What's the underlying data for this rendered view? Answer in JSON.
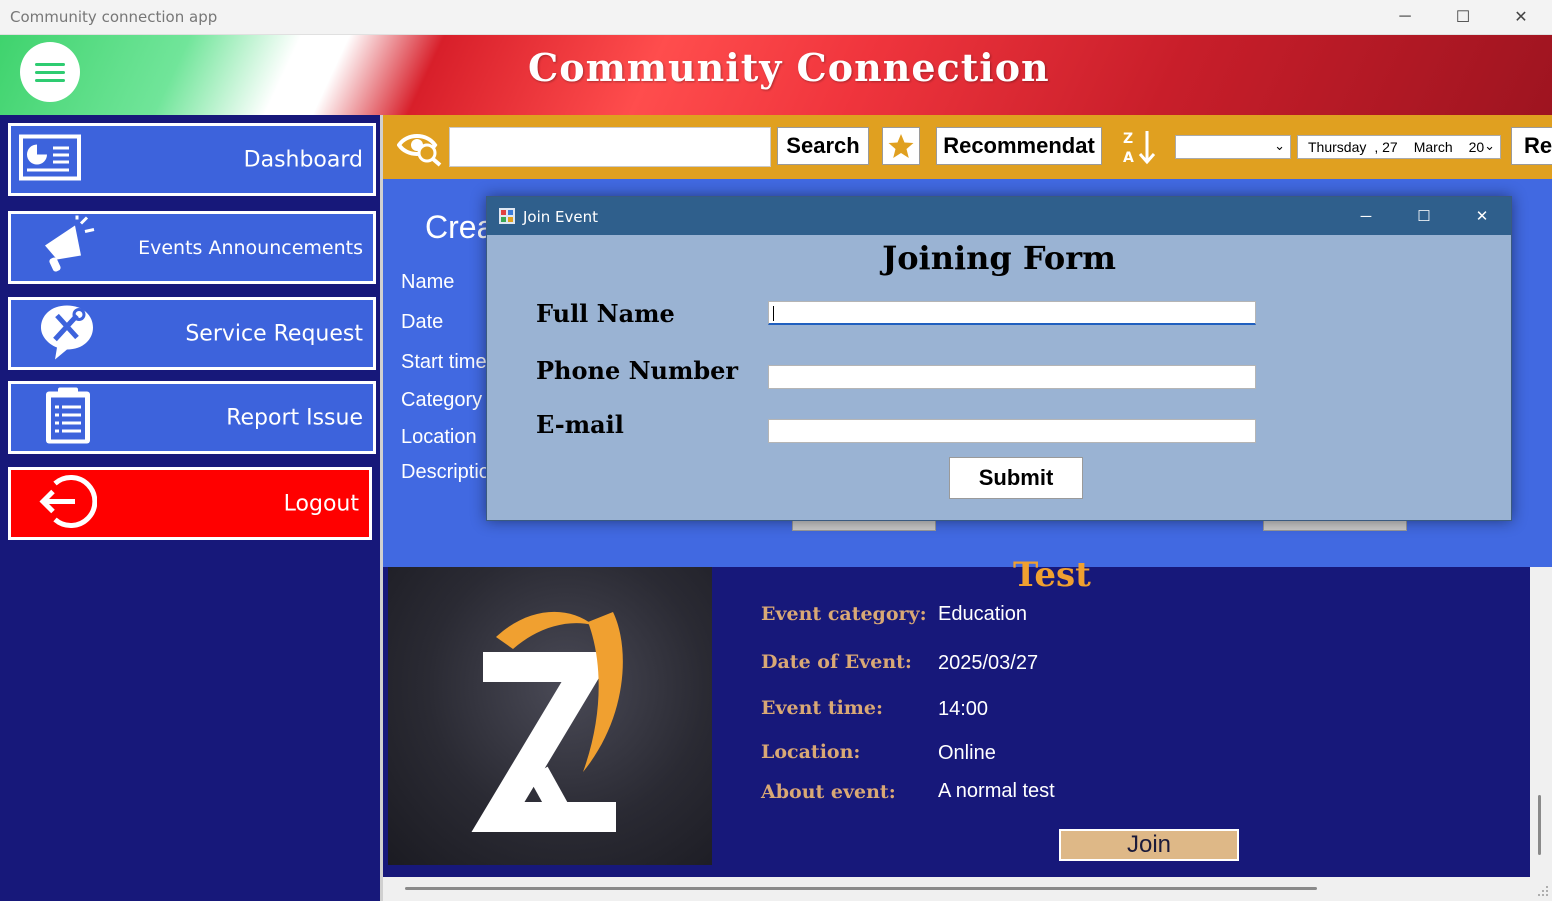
{
  "window": {
    "title": "Community connection app",
    "minimize": "─",
    "maximize": "☐",
    "close": "✕"
  },
  "header": {
    "app_title": "Community Connection",
    "colors": {
      "green": "#3fd36d",
      "red": "#d81f2a"
    }
  },
  "sidebar": {
    "items": [
      {
        "label": "Dashboard",
        "icon": "dashboard-chart-icon"
      },
      {
        "label": "Events Announcements",
        "icon": "megaphone-icon"
      },
      {
        "label": "Service Request",
        "icon": "tools-icon"
      },
      {
        "label": "Report Issue",
        "icon": "clipboard-icon"
      },
      {
        "label": "Logout",
        "icon": "logout-icon",
        "color": "#ff0000"
      }
    ]
  },
  "toolbar": {
    "search_value": "",
    "search_label": "Search",
    "favorite_icon": "star-icon",
    "recommend_label": "Recommendat",
    "sort_icon": "sort-z-a-icon",
    "category_select": "",
    "date_weekday": "Thursday",
    "date_day": ", 27",
    "date_month": "March",
    "date_year": "20",
    "extra_label": "Re"
  },
  "create_panel": {
    "title": "Crea",
    "labels": {
      "name": "Name",
      "date": "Date",
      "start_time": "Start time",
      "category": "Category",
      "location": "Location",
      "description": "Descriptio"
    }
  },
  "event": {
    "title": "Test",
    "labels": {
      "category": "Event category:",
      "date": "Date of Event:",
      "time": "Event time:",
      "location": "Location:",
      "about": "About event:"
    },
    "values": {
      "category": "Education",
      "date": "2025/03/27",
      "time": "14:00",
      "location": "Online",
      "about": "A normal test"
    },
    "join_label": "Join",
    "colors": {
      "label": "#d9a875",
      "title": "#f0a030",
      "join_bg": "#deb887"
    }
  },
  "dialog": {
    "title": "Join Event",
    "heading": "Joining Form",
    "fields": {
      "full_name": {
        "label": "Full Name",
        "value": ""
      },
      "phone": {
        "label": "Phone Number",
        "value": ""
      },
      "email": {
        "label": "E-mail",
        "value": ""
      }
    },
    "submit_label": "Submit",
    "minimize": "─",
    "maximize": "☐",
    "close": "✕"
  }
}
